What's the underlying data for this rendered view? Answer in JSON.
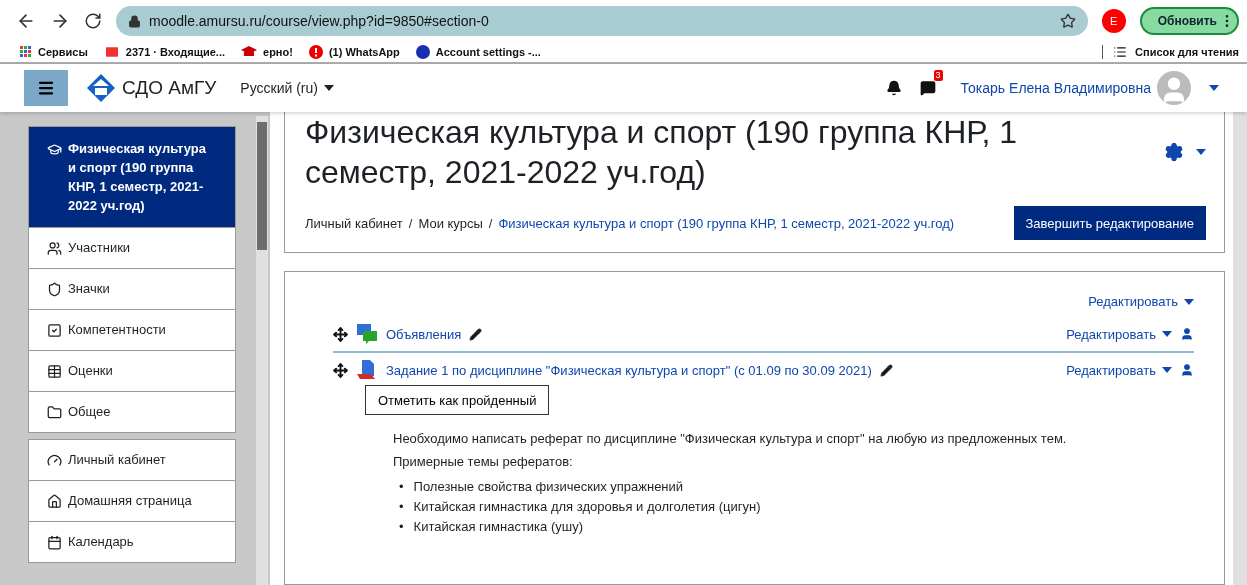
{
  "browser": {
    "url": "moodle.amursu.ru/course/view.php?id=9850#section-0",
    "profile_initial": "E",
    "update_button": "Обновить",
    "bookmarks": [
      {
        "label": "Сервисы"
      },
      {
        "label": "2371 · Входящие..."
      },
      {
        "label": "ерно!"
      },
      {
        "label": "(1) WhatsApp"
      },
      {
        "label": "Account settings -..."
      }
    ],
    "reading_list": "Список для чтения"
  },
  "navbar": {
    "site_name": "СДО АмГУ",
    "language": "Русский (ru)",
    "message_count": "3",
    "user_name": "Токарь Елена Владимировна"
  },
  "sidebar": {
    "groups": [
      [
        {
          "label": "Физическая культура и спорт (190 группа КНР, 1 семестр, 2021-2022 уч.год)",
          "selected": true
        },
        {
          "label": "Участники",
          "selected": false
        },
        {
          "label": "Значки",
          "selected": false
        },
        {
          "label": "Компетентности",
          "selected": false
        },
        {
          "label": "Оценки",
          "selected": false
        },
        {
          "label": "Общее",
          "selected": false
        }
      ],
      [
        {
          "label": "Личный кабинет",
          "selected": false
        },
        {
          "label": "Домашняя страница",
          "selected": false
        },
        {
          "label": "Календарь",
          "selected": false
        }
      ]
    ]
  },
  "page": {
    "title": "Физическая культура и спорт (190 группа КНР, 1 семестр, 2021-2022 уч.год)",
    "breadcrumb_separator": "/",
    "breadcrumbs": [
      "Личный кабинет",
      "Мои курсы",
      "Физическая культура и спорт (190 группа КНР, 1 семестр, 2021-2022 уч.год)"
    ],
    "finish_button": "Завершить редактирование"
  },
  "section": {
    "edit_menu": "Редактировать",
    "activities": [
      {
        "kind": "forum",
        "name": "Объявления",
        "edit_menu": "Редактировать"
      },
      {
        "kind": "assign",
        "name": "Задание 1 по дисциплине \"Физическая культура и спорт\" (с 01.09 по 30.09 2021)",
        "edit_menu": "Редактировать",
        "completion_button": "Отметить как пройденный"
      }
    ],
    "description": {
      "bullet": "•",
      "paragraphs": [
        "Необходимо написать реферат по дисциплине \"Физическая культура и спорт\" на любую из предложенных тем.",
        "Примерные темы рефератов:"
      ],
      "topics": [
        "Полезные свойства физических упражнений",
        "Китайская гимнастика для здоровья и долголетия (цигун)",
        "Китайская гимнастика (ушу)"
      ]
    }
  }
}
